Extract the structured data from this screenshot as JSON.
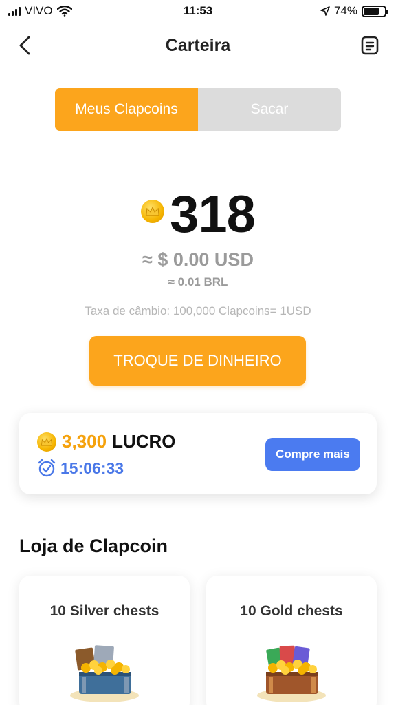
{
  "status_bar": {
    "carrier": "VIVO",
    "time": "11:53",
    "battery": "74%",
    "battery_level": 0.74
  },
  "header": {
    "title": "Carteira",
    "back_icon": "chevron-left-icon",
    "right_icon": "document-icon"
  },
  "tabs": [
    {
      "label": "Meus Clapcoins",
      "active": true
    },
    {
      "label": "Sacar",
      "active": false
    }
  ],
  "balance": {
    "coins": "318",
    "usd": "≈ $ 0.00 USD",
    "brl": "≈ 0.01 BRL",
    "rate": "Taxa de câmbio: 100,000 Clapcoins= 1USD"
  },
  "exchange_button": "TROQUE DE DINHEIRO",
  "profit": {
    "amount": "3,300",
    "label": "LUCRO",
    "timer": "15:06:33",
    "button": "Compre mais"
  },
  "shop": {
    "title": "Loja de Clapcoin",
    "items": [
      {
        "title": "10 Silver chests",
        "chest_color": "#3f6f9a"
      },
      {
        "title": "10 Gold chests",
        "chest_color": "#a0562b"
      }
    ]
  },
  "colors": {
    "accent": "#fca51c",
    "blue": "#4b7bf0"
  }
}
